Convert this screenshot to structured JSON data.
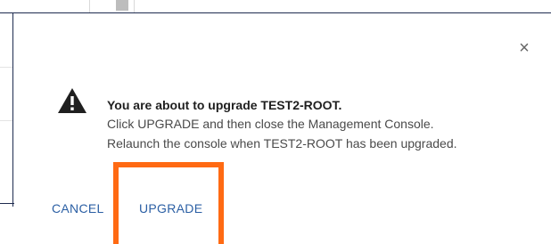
{
  "dialog": {
    "close_glyph": "×",
    "title": "You are about to upgrade TEST2-ROOT.",
    "line1": "Click UPGRADE and then close the Management Console.",
    "line2": "Relaunch the console when TEST2-ROOT has been upgraded.",
    "icon": "warning-triangle-icon",
    "buttons": {
      "cancel": "CANCEL",
      "upgrade": "UPGRADE"
    }
  },
  "colors": {
    "accent": "#2b5fa4",
    "highlight": "#ff6a13",
    "border": "#1e2b4f"
  }
}
